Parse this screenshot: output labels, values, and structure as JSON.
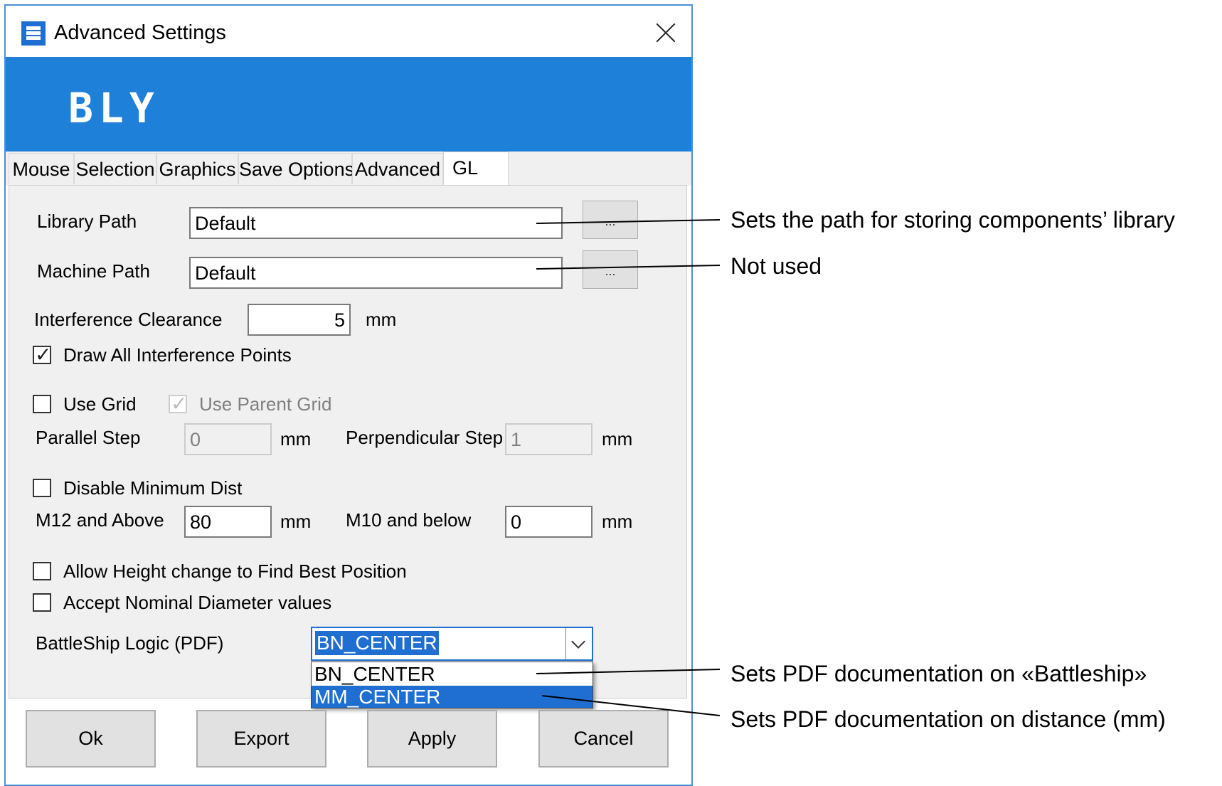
{
  "window": {
    "title": "Advanced Settings",
    "icon": "app-logo-icon",
    "close_icon": "close-icon"
  },
  "banner": {
    "logo_text": "BLY",
    "color": "#1e80d8"
  },
  "tabs": [
    {
      "label": "Mouse"
    },
    {
      "label": "Selection"
    },
    {
      "label": "Graphics"
    },
    {
      "label": "Save Options"
    },
    {
      "label": "Advanced"
    },
    {
      "label": "GL",
      "active": true
    }
  ],
  "form": {
    "library_path": {
      "label": "Library Path",
      "value": "Default",
      "browse_label": "..."
    },
    "machine_path": {
      "label": "Machine Path",
      "value": "Default",
      "browse_label": "..."
    },
    "interference_clearance": {
      "label": "Interference Clearance",
      "value": "5",
      "unit": "mm"
    },
    "draw_all_points": {
      "label": "Draw All Interference Points",
      "checked": true
    },
    "use_grid": {
      "label": "Use Grid",
      "checked": false
    },
    "use_parent_grid": {
      "label": "Use Parent Grid",
      "checked": true,
      "disabled": true
    },
    "parallel_step": {
      "label": "Parallel Step",
      "value": "0",
      "unit": "mm"
    },
    "perpendicular_step": {
      "label": "Perpendicular Step",
      "value": "1",
      "unit": "mm"
    },
    "disable_min_dist": {
      "label": "Disable Minimum Dist",
      "checked": false
    },
    "m12_above": {
      "label": "M12 and Above",
      "value": "80",
      "unit": "mm"
    },
    "m10_below": {
      "label": "M10 and below",
      "value": "0",
      "unit": "mm"
    },
    "allow_height_change": {
      "label": "Allow Height change to Find Best Position",
      "checked": false
    },
    "accept_nominal": {
      "label": "Accept Nominal Diameter values",
      "checked": false
    },
    "battleship_logic": {
      "label": "BattleShip Logic (PDF)",
      "selected": "BN_CENTER",
      "options": [
        "BN_CENTER",
        "MM_CENTER"
      ],
      "highlighted": "MM_CENTER"
    }
  },
  "buttons": {
    "ok": "Ok",
    "export": "Export",
    "apply": "Apply",
    "cancel": "Cancel"
  },
  "annotations": [
    "Sets the path for storing components’ library",
    "Not used",
    "Sets PDF documentation on «Battleship»",
    "Sets PDF documentation on distance (mm)"
  ],
  "colors": {
    "accent": "#1e6fd1",
    "border": "#4a90d9"
  }
}
